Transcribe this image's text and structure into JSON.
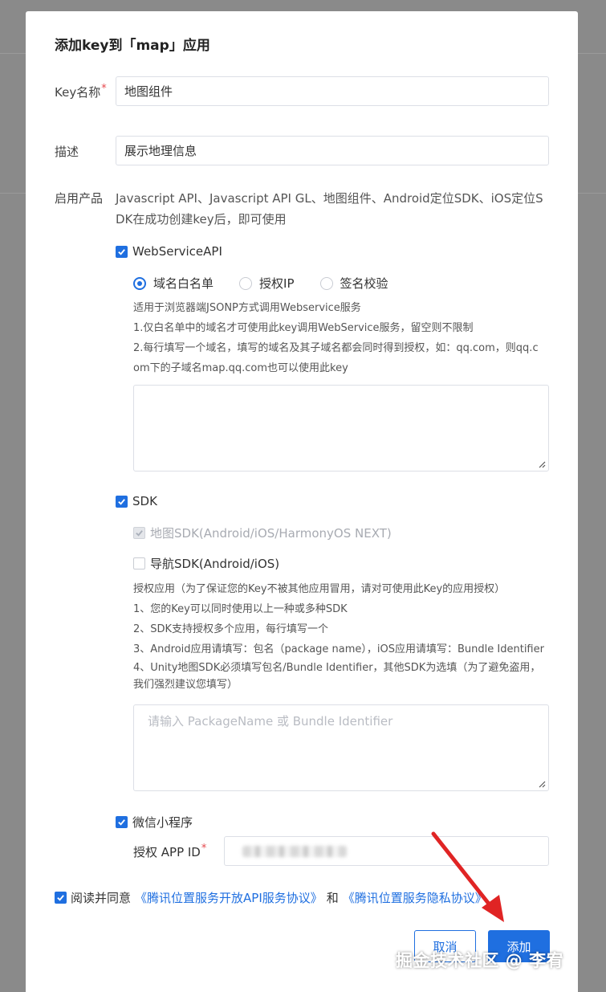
{
  "dialog": {
    "title": "添加key到「map」应用",
    "key_name": {
      "label": "Key名称",
      "required_mark": "*",
      "value": "地图组件"
    },
    "description": {
      "label": "描述",
      "value": "展示地理信息"
    },
    "products": {
      "label": "启用产品",
      "intro_line1": "Javascript API、Javascript API GL、地图组件、Android定位SDK、iOS定位S",
      "intro_line2": "DK在成功创建key后，即可使用"
    },
    "webservice": {
      "label": "WebServiceAPI",
      "checked": true,
      "modes": [
        {
          "label": "域名白名单",
          "selected": true
        },
        {
          "label": "授权IP",
          "selected": false
        },
        {
          "label": "签名校验",
          "selected": false
        }
      ],
      "help": [
        "适用于浏览器端JSONP方式调用Webservice服务",
        "1.仅白名单中的域名才可使用此key调用WebService服务，留空则不限制",
        "2.每行填写一个域名，填写的域名及其子域名都会同时得到授权，如：qq.com，则qq.c",
        "om下的子域名map.qq.com也可以使用此key"
      ],
      "textarea_value": ""
    },
    "sdk": {
      "label": "SDK",
      "checked": true,
      "map_sdk": {
        "label": "地图SDK(Android/iOS/HarmonyOS NEXT)",
        "checked": true,
        "disabled": true
      },
      "nav_sdk": {
        "label": "导航SDK(Android/iOS)",
        "checked": false
      },
      "help": [
        "授权应用（为了保证您的Key不被其他应用冒用，请对可使用此Key的应用授权）",
        "1、您的Key可以同时使用以上一种或多种SDK",
        "2、SDK支持授权多个应用，每行填写一个",
        "3、Android应用请填写：包名（package name），iOS应用请填写：Bundle Identifier",
        "4、Unity地图SDK必须填写包名/Bundle Identifier，其他SDK为选填（为了避免盗用，",
        "我们强烈建议您填写）"
      ],
      "textarea_placeholder": "请输入 PackageName 或 Bundle Identifier"
    },
    "miniprogram": {
      "label": "微信小程序",
      "checked": true,
      "app_id_label": "授权 APP ID",
      "required_mark": "*"
    },
    "agreement": {
      "checked": true,
      "prefix": "阅读并同意",
      "link1": "《腾讯位置服务开放API服务协议》",
      "joiner": "和",
      "link2": "《腾讯位置服务隐私协议》"
    },
    "buttons": {
      "cancel": "取消",
      "submit": "添加"
    }
  },
  "watermark": "掘金技术社区 @ 李宥",
  "colors": {
    "accent": "#1f6fe0",
    "required": "#e5484d",
    "annotation_arrow": "#e02424"
  },
  "icons": [
    "check-icon",
    "resize-grip-icon",
    "arrow-annotation"
  ]
}
